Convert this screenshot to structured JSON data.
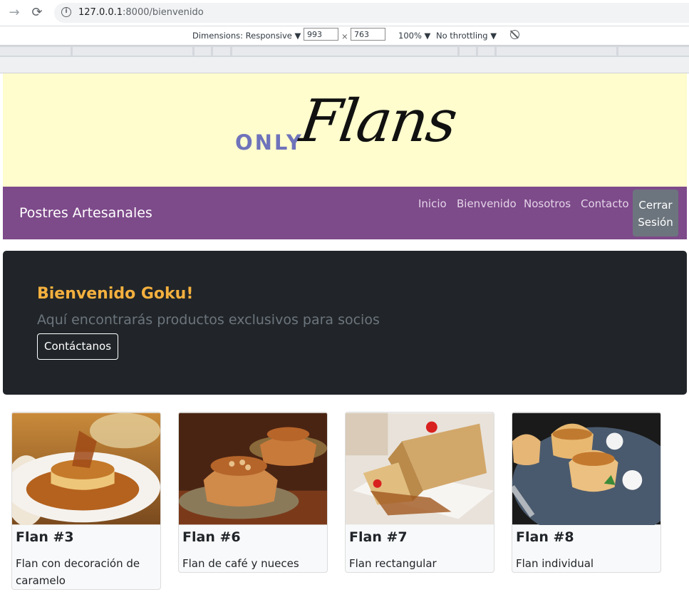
{
  "browser": {
    "url_host": "127.0.0.1",
    "url_path": ":8000/bienvenido"
  },
  "devtools": {
    "dimensions_label": "Dimensions: Responsive ▼",
    "width": "993",
    "times": "×",
    "height": "763",
    "zoom": "100% ▼",
    "throttling": "No throttling ▼"
  },
  "banner": {
    "logo_only": "ONLY",
    "logo_flans": "Flans"
  },
  "navbar": {
    "brand": "Postres Artesanales",
    "links": [
      "Inicio",
      "Bienvenido",
      "Nosotros",
      "Contacto"
    ],
    "logout_line1": "Cerrar",
    "logout_line2": "Sesión"
  },
  "jumbotron": {
    "title": "Bienvenido Goku!",
    "subtitle": "Aquí encontrarás productos exclusivos para socios",
    "button": "Contáctanos"
  },
  "cards": [
    {
      "title": "Flan #3",
      "description": "Flan con decoración de caramelo"
    },
    {
      "title": "Flan #6",
      "description": "Flan de café y nueces"
    },
    {
      "title": "Flan #7",
      "description": "Flan rectangular"
    },
    {
      "title": "Flan #8",
      "description": "Flan individual"
    }
  ],
  "colors": {
    "banner_bg": "#fffccd",
    "navbar_bg": "#7d4a8a",
    "jumbotron_bg": "#212529",
    "welcome_title": "#f4b03e",
    "logout_bg": "#6c757d"
  }
}
